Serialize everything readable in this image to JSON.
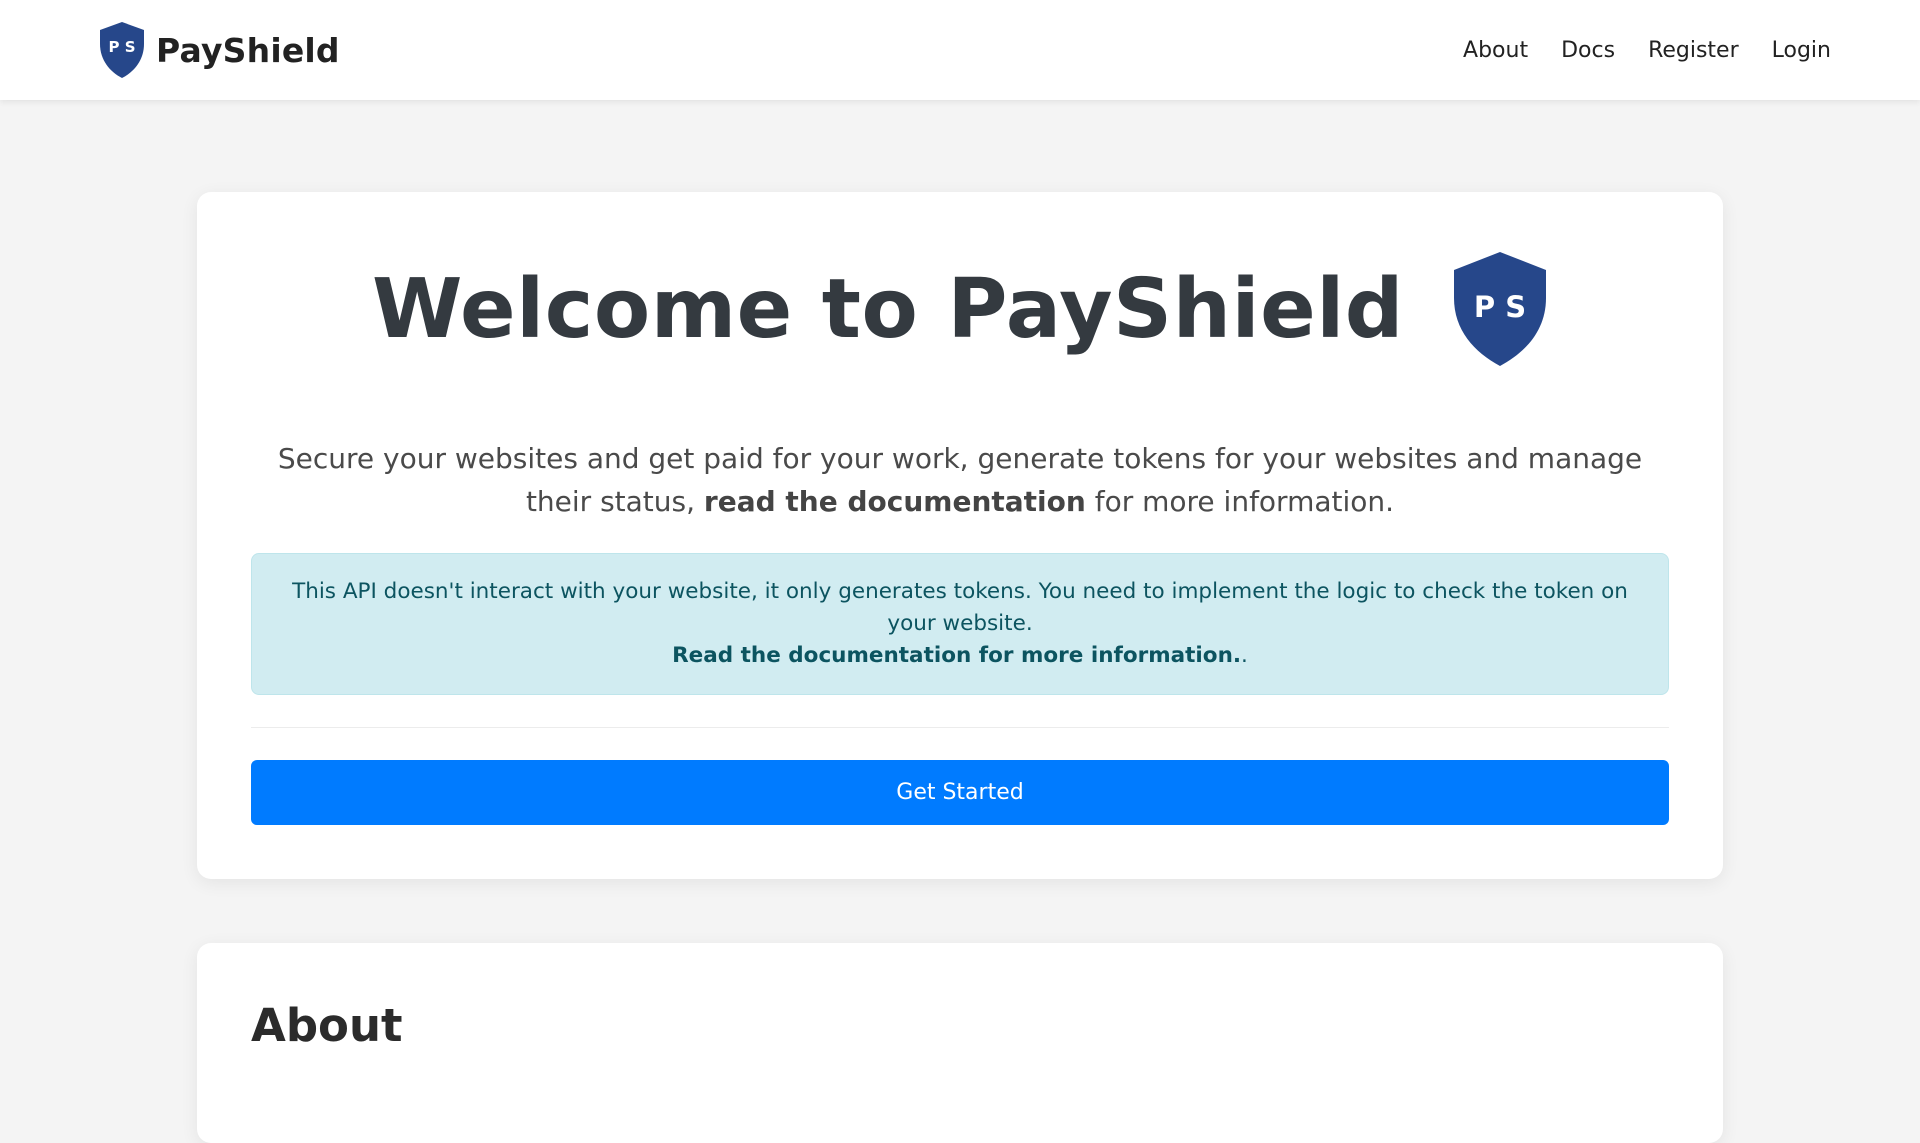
{
  "navbar": {
    "brand_name": "PayShield",
    "logo_initials": "P S",
    "links": [
      {
        "label": "About"
      },
      {
        "label": "Docs"
      },
      {
        "label": "Register"
      },
      {
        "label": "Login"
      }
    ]
  },
  "hero": {
    "title": "Welcome to PayShield",
    "logo_initials": "P S",
    "lead_before": "Secure your websites and get paid for your work, generate tokens for your websites and manage their status, ",
    "lead_link": "read the documentation",
    "lead_after": " for more information.",
    "alert_text": "This API doesn't interact with your website, it only generates tokens. You need to implement the logic to check the token on your website.",
    "alert_link": "Read the documentation for more information.",
    "alert_after": ".",
    "cta_label": "Get Started"
  },
  "about": {
    "title": "About"
  },
  "colors": {
    "shield": "#26478a",
    "primary_button": "#007bff",
    "alert_bg": "#d1ecf1",
    "alert_text": "#0c5460",
    "page_bg": "#f4f4f4"
  },
  "icons": {
    "brand": "shield-icon",
    "hero": "shield-icon"
  }
}
